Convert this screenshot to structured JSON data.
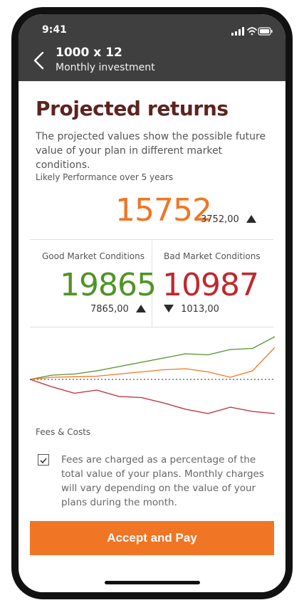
{
  "status_bar": {
    "time": "9:41"
  },
  "header": {
    "title": "1000 x 12",
    "subtitle": "Monthly investment"
  },
  "main": {
    "heading": "Projected returns",
    "intro": "The projected values show the possible future value of your plan in different market conditions.",
    "likely": {
      "label": "Likely Performance over 5 years",
      "value": "15752",
      "delta": "3752,00"
    },
    "good": {
      "label": "Good Market Conditions",
      "value": "19865",
      "delta": "7865,00"
    },
    "bad": {
      "label": "Bad Market Conditions",
      "value": "10987",
      "delta": "1013,00"
    }
  },
  "fees": {
    "label": "Fees & Costs",
    "checked": true,
    "text": "Fees are charged as a percentage of the total value of your plans. Monthly charges will vary depending on the value of your plans during the month."
  },
  "accept_button": {
    "label": "Accept and Pay"
  },
  "colors": {
    "likely": "#f07524",
    "good": "#4f9427",
    "bad": "#c0282e",
    "header": "#3f3f3f"
  },
  "chart_data": {
    "type": "line",
    "x": [
      0,
      1,
      2,
      3,
      4,
      5,
      6,
      7,
      8,
      9,
      10,
      11
    ],
    "series": [
      {
        "values": [
          1000,
          1040,
          1050,
          1080,
          1120,
          1160,
          1200,
          1240,
          1230,
          1280,
          1290,
          1400
        ],
        "color": "#4f9427"
      },
      {
        "values": [
          1000,
          1020,
          1025,
          1030,
          1050,
          1070,
          1090,
          1100,
          1070,
          1020,
          1080,
          1300
        ],
        "color": "#f07524"
      },
      {
        "values": [
          1000,
          930,
          870,
          900,
          840,
          830,
          780,
          720,
          680,
          740,
          700,
          680
        ],
        "color": "#c0282e"
      }
    ],
    "baseline": 1000,
    "ylim": [
      620,
      1420
    ],
    "grid": false
  }
}
